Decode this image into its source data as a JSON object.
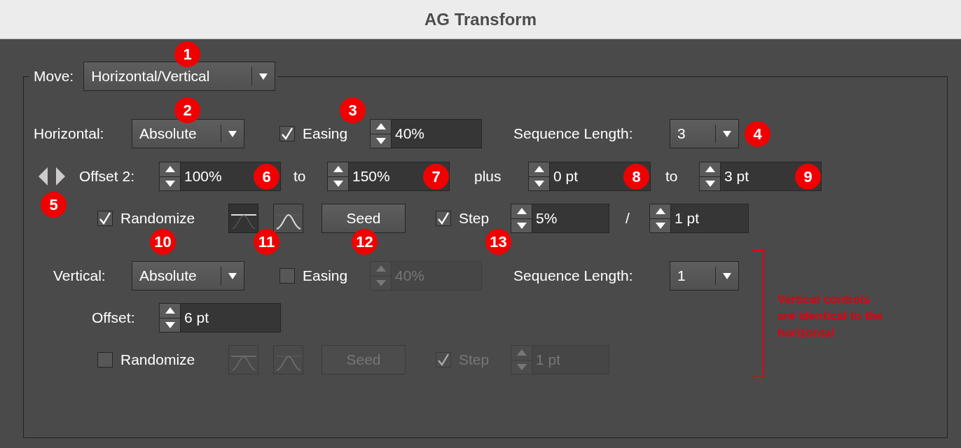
{
  "window": {
    "title": "AG Transform"
  },
  "move": {
    "label": "Move:",
    "value": "Horizontal/Vertical"
  },
  "rows": [
    [
      {
        "kind": "label",
        "text": "Horizontal:"
      },
      {
        "kind": "dropdown",
        "value": "Absolute"
      },
      {
        "kind": "checkbox",
        "label": "Easing",
        "checked": true,
        "disabled": false
      },
      {
        "kind": "spinner",
        "value": "40%",
        "disabled": false
      },
      {
        "kind": "label",
        "text": "Sequence Length:"
      },
      {
        "kind": "dropdown",
        "value": "3"
      }
    ],
    [
      {
        "kind": "arrows"
      },
      {
        "kind": "label",
        "text": "Offset 2:"
      },
      {
        "kind": "spinner",
        "value": "100%",
        "disabled": false
      },
      {
        "kind": "label",
        "text": "to"
      },
      {
        "kind": "spinner",
        "value": "150%",
        "disabled": false
      },
      {
        "kind": "label",
        "text": "plus"
      },
      {
        "kind": "spinner",
        "value": "0 pt",
        "disabled": false
      },
      {
        "kind": "label",
        "text": "to"
      },
      {
        "kind": "spinner",
        "value": "3 pt",
        "disabled": false
      }
    ],
    [
      {
        "kind": "checkbox",
        "label": "Randomize",
        "checked": true,
        "disabled": false
      },
      {
        "kind": "curve-flat",
        "selected": true,
        "disabled": false
      },
      {
        "kind": "curve-bell",
        "selected": false,
        "disabled": false
      },
      {
        "kind": "button",
        "label": "Seed",
        "disabled": false
      },
      {
        "kind": "checkbox",
        "label": "Step",
        "checked": true,
        "disabled": false
      },
      {
        "kind": "spinner",
        "value": "5%",
        "disabled": false
      },
      {
        "kind": "label",
        "text": "/"
      },
      {
        "kind": "spinner",
        "value": "1 pt",
        "disabled": false
      }
    ],
    [
      {
        "kind": "label",
        "text": "Vertical:"
      },
      {
        "kind": "dropdown",
        "value": "Absolute"
      },
      {
        "kind": "checkbox",
        "label": "Easing",
        "checked": false,
        "disabled": false
      },
      {
        "kind": "spinner",
        "value": "40%",
        "disabled": true
      },
      {
        "kind": "label",
        "text": "Sequence Length:"
      },
      {
        "kind": "dropdown",
        "value": "1"
      }
    ],
    [
      {
        "kind": "label",
        "text": "Offset:"
      },
      {
        "kind": "spinner",
        "value": "6 pt",
        "disabled": false
      }
    ],
    [
      {
        "kind": "checkbox",
        "label": "Randomize",
        "checked": false,
        "disabled": false
      },
      {
        "kind": "curve-flat",
        "selected": false,
        "disabled": true
      },
      {
        "kind": "curve-bell",
        "selected": false,
        "disabled": true
      },
      {
        "kind": "button",
        "label": "Seed",
        "disabled": true
      },
      {
        "kind": "checkbox",
        "label": "Step",
        "checked": true,
        "disabled": true
      },
      {
        "kind": "spinner",
        "value": "1 pt",
        "disabled": true
      }
    ]
  ],
  "callouts": [
    {
      "text": "1"
    },
    {
      "text": "2"
    },
    {
      "text": "3"
    },
    {
      "text": "4"
    },
    {
      "text": "5"
    },
    {
      "text": "6"
    },
    {
      "text": "7"
    },
    {
      "text": "8"
    },
    {
      "text": "9"
    },
    {
      "text": "10"
    },
    {
      "text": "11"
    },
    {
      "text": "12"
    },
    {
      "text": "13"
    }
  ],
  "note": {
    "text": "Vertical controls are identical to the horizontal"
  }
}
